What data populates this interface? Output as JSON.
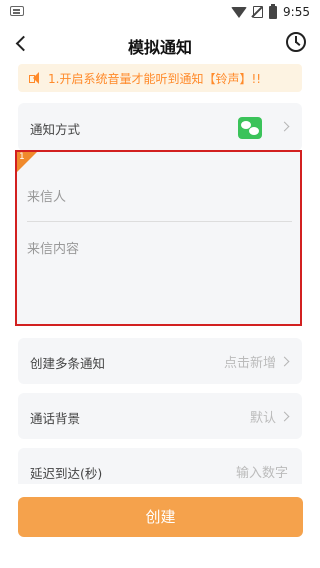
{
  "status_bar": {
    "time": "9:55"
  },
  "nav": {
    "title": "模拟通知"
  },
  "tip": {
    "text": "1.开启系统音量才能听到通知【铃声】!!"
  },
  "notify_method": {
    "label": "通知方式",
    "icon": "wechat-icon"
  },
  "compose": {
    "badge_number": "1",
    "sender_placeholder": "来信人",
    "content_placeholder": "来信内容"
  },
  "multi_notify": {
    "label": "创建多条通知",
    "value": "点击新增"
  },
  "call_background": {
    "label": "通话背景",
    "value": "默认"
  },
  "delay": {
    "label": "延迟到达(秒)",
    "placeholder": "输入数字"
  },
  "create_button": {
    "label": "创建"
  },
  "colors": {
    "accent": "#f5a24c",
    "highlight_border": "#d22020",
    "tip_text": "#ff8a2a",
    "wechat": "#3bc35a"
  }
}
